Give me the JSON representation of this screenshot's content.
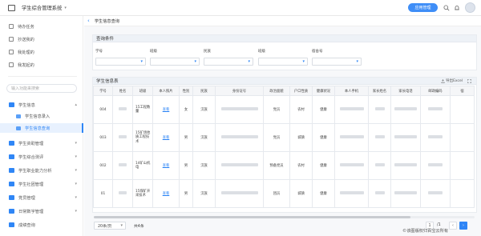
{
  "app": {
    "title": "学生综合管理系统",
    "app_button": "应用管理"
  },
  "sidebar": {
    "top_items": [
      {
        "label": "待办任务",
        "icon": "task-icon"
      },
      {
        "label": "抄送我的",
        "icon": "cc-icon"
      },
      {
        "label": "我处理的",
        "icon": "handled-icon"
      },
      {
        "label": "我发起的",
        "icon": "initiated-icon"
      }
    ],
    "search_placeholder": "输入功能来搜索",
    "menu": [
      {
        "label": "学生信息",
        "level": 1,
        "expanded": true
      },
      {
        "label": "学生信息录入",
        "level": 2
      },
      {
        "label": "学生信息查询",
        "level": 2,
        "active": true
      },
      {
        "label": "学生资助管理",
        "level": 1
      },
      {
        "label": "学生综合测评",
        "level": 1
      },
      {
        "label": "学生职业能力分析",
        "level": 1
      },
      {
        "label": "学生社团管理",
        "level": 1
      },
      {
        "label": "党员管理",
        "level": 1
      },
      {
        "label": "日常数字管理",
        "level": 1
      },
      {
        "label": "成绩查询",
        "level": 1
      }
    ]
  },
  "breadcrumb": {
    "title": "学生信息查询"
  },
  "query": {
    "title": "查询条件",
    "fields": [
      {
        "label": "学号"
      },
      {
        "label": "班级"
      },
      {
        "label": "民族"
      },
      {
        "label": "班级"
      },
      {
        "label": "宿舍号"
      }
    ]
  },
  "info": {
    "title": "学生信息表",
    "export_label": "导出Excel",
    "columns": [
      "学号",
      "姓名",
      "班级",
      "本人照片",
      "性别",
      "民族",
      "身份证号",
      "政治面貌",
      "户口性质",
      "健康状况",
      "本人手机",
      "家长姓名",
      "家长电话",
      "邮政编码",
      "宿"
    ],
    "rows": [
      {
        "id": "004",
        "class": "15工程数量",
        "photo": "查看",
        "gender": "女",
        "ethnicity": "汉族",
        "politics": "党员",
        "hukou": "农村",
        "health": "健康"
      },
      {
        "id": "003",
        "class": "15矿场地质工程技术",
        "photo": "查看",
        "gender": "男",
        "ethnicity": "汉族",
        "politics": "党员",
        "hukou": "城镇",
        "health": "健康"
      },
      {
        "id": "002",
        "class": "14矿山机电",
        "photo": "查看",
        "gender": "男",
        "ethnicity": "汉族",
        "politics": "预备党员",
        "hukou": "农村",
        "health": "健康"
      },
      {
        "id": "01",
        "class": "15煤矿开采技术",
        "photo": "查看",
        "gender": "男",
        "ethnicity": "汉族",
        "politics": "团员",
        "hukou": "城镇",
        "health": "健康"
      }
    ]
  },
  "pagination": {
    "page_size": "20条/页",
    "total": "共4条",
    "current_page": "1",
    "total_pages": "/1"
  },
  "watermark": "©该图版权归百宝云所有",
  "colors": {
    "accent": "#2f86f6",
    "app_button": "#3f8ef7"
  }
}
